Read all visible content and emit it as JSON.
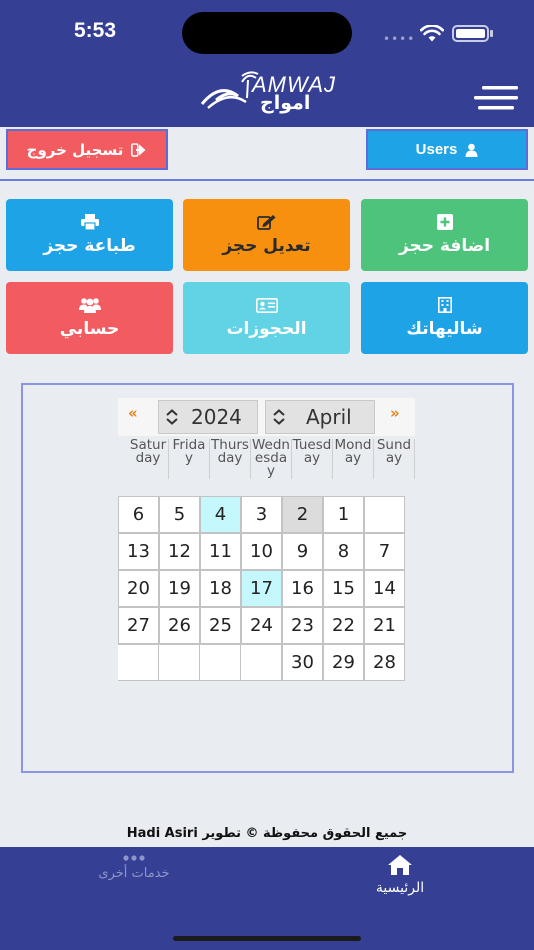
{
  "status_bar": {
    "time": "5:53"
  },
  "header": {
    "logo_text_latin": "AMWAJ",
    "logo_text_arabic": "امواج",
    "menu_icon": "hamburger-icon"
  },
  "actions": {
    "logout_label": "تسجيل خروج",
    "logout_icon": "sign-out-icon",
    "users_label": "Users",
    "users_icon": "user-icon"
  },
  "tiles": [
    {
      "label": "اضافة حجز",
      "icon": "plus-square-icon",
      "color": "#4dc37b"
    },
    {
      "label": "تعديل حجز",
      "icon": "edit-icon",
      "color": "#f7900f"
    },
    {
      "label": "طباعة حجز",
      "icon": "print-icon",
      "color": "#1fa3e7"
    },
    {
      "label": "شاليهاتك",
      "icon": "building-icon",
      "color": "#1fa3e7"
    },
    {
      "label": "الحجوزات",
      "icon": "id-card-icon",
      "color": "#62d2e5"
    },
    {
      "label": "حسابي",
      "icon": "users-icon",
      "color": "#f25b5f"
    }
  ],
  "calendar": {
    "prev_label": "«",
    "next_label": "»",
    "year": "2024",
    "month": "April",
    "weekdays": [
      "Sunday",
      "Monday",
      "Tuesday",
      "Wednesday",
      "Thursday",
      "Friday",
      "Saturday"
    ],
    "weeks": [
      [
        "6",
        "5",
        "4",
        "3",
        "2",
        "1",
        ""
      ],
      [
        "13",
        "12",
        "11",
        "10",
        "9",
        "8",
        "7"
      ],
      [
        "20",
        "19",
        "18",
        "17",
        "16",
        "15",
        "14"
      ],
      [
        "27",
        "26",
        "25",
        "24",
        "23",
        "22",
        "21"
      ],
      [
        "",
        "",
        "",
        "",
        "30",
        "29",
        "28"
      ]
    ],
    "highlight_gray": "2",
    "highlight_teal": [
      "4",
      "17"
    ]
  },
  "footer": {
    "copyright": "جميع الحقوق محفوظة © تطوير Hadi Asiri"
  },
  "tabbar": {
    "home_label": "الرئيسية",
    "home_icon": "home-icon",
    "more_label": "خدمات أخرى",
    "more_icon": "more-dots-icon"
  }
}
